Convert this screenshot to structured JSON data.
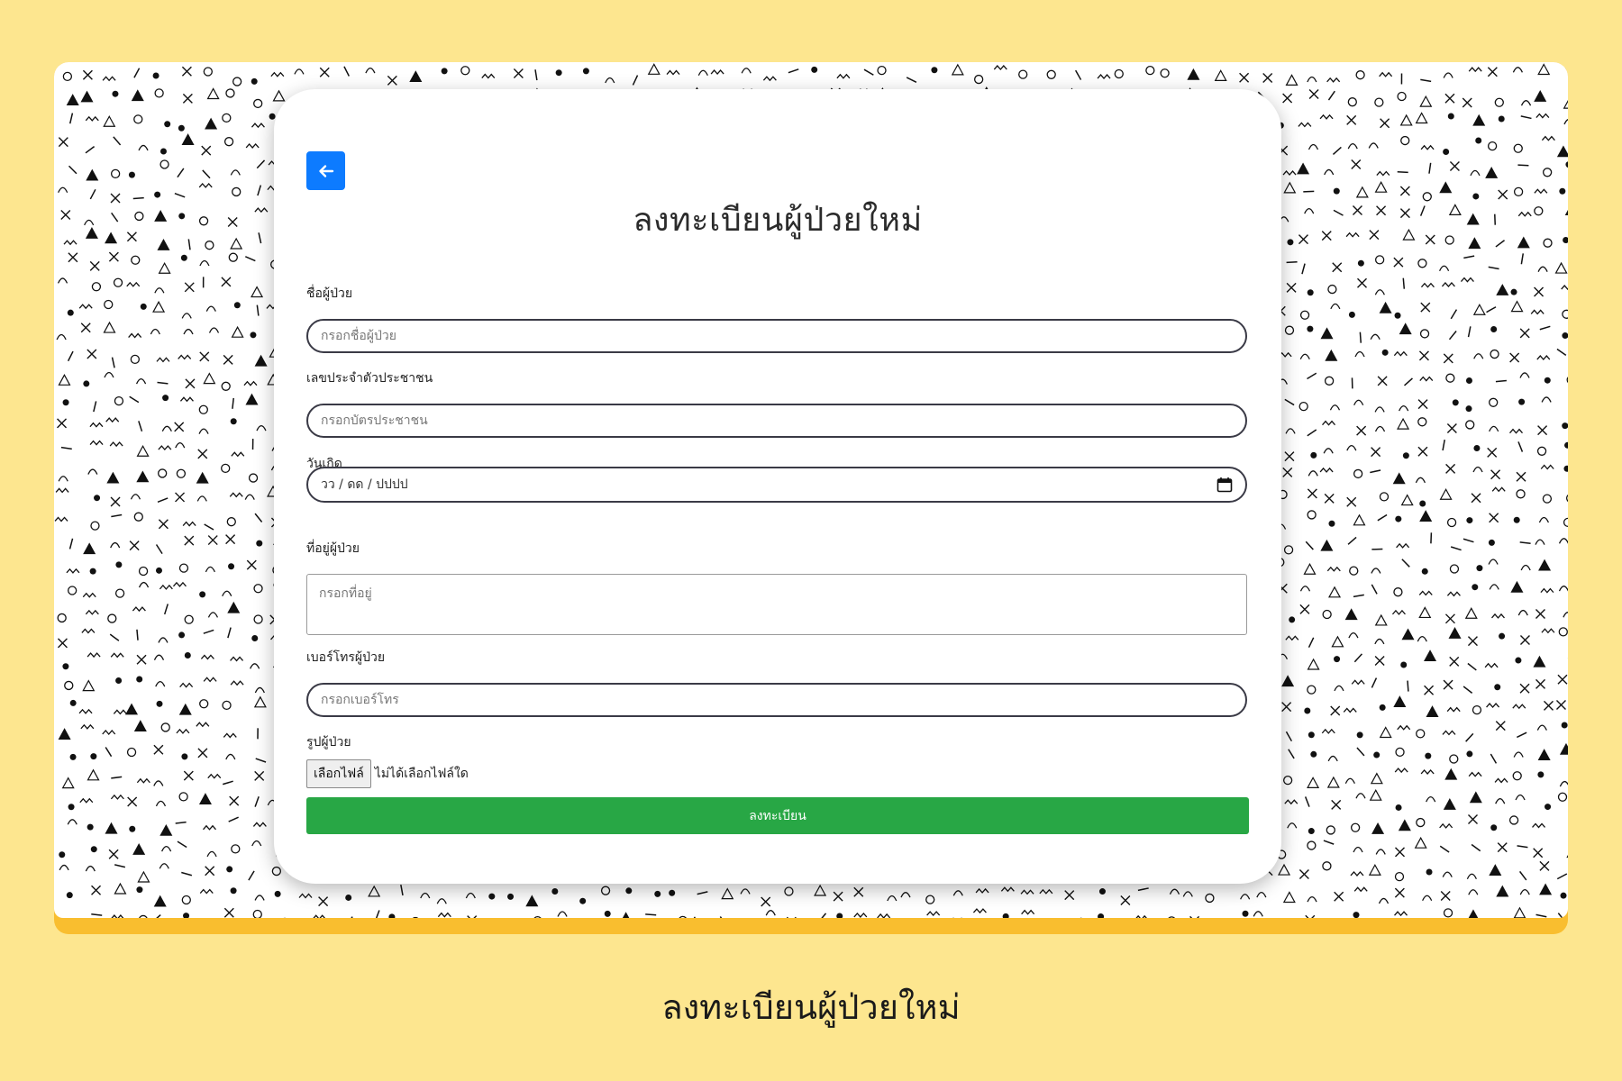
{
  "form": {
    "title": "ลงทะเบียนผู้ป่วยใหม่",
    "back_icon": "arrow-left-icon",
    "fields": {
      "name": {
        "label": "ชื่อผู้ป่วย",
        "placeholder": "กรอกชื่อผู้ป่วย",
        "value": ""
      },
      "citizen_id": {
        "label": "เลขประจำตัวประชาชน",
        "placeholder": "กรอกบัตรประชาชน",
        "value": ""
      },
      "birthdate": {
        "label": "วันเกิด",
        "display": "วว / ดด / ปปปป",
        "icon": "calendar-icon"
      },
      "address": {
        "label": "ที่อยู่ผู้ป่วย",
        "placeholder": "กรอกที่อยู่",
        "value": ""
      },
      "phone": {
        "label": "เบอร์โทรผู้ป่วย",
        "placeholder": "กรอกเบอร์โทร",
        "value": ""
      },
      "photo": {
        "label": "รูปผู้ป่วย",
        "button": "เลือกไฟล์",
        "status": "ไม่ได้เลือกไฟล์ใด"
      }
    },
    "submit_label": "ลงทะเบียน"
  },
  "caption": "ลงทะเบียนผู้ป่วยใหม่",
  "colors": {
    "page_background": "#fde68f",
    "frame_accent": "#f9be2f",
    "back_button": "#0d7bff",
    "submit_button": "#28a745"
  }
}
